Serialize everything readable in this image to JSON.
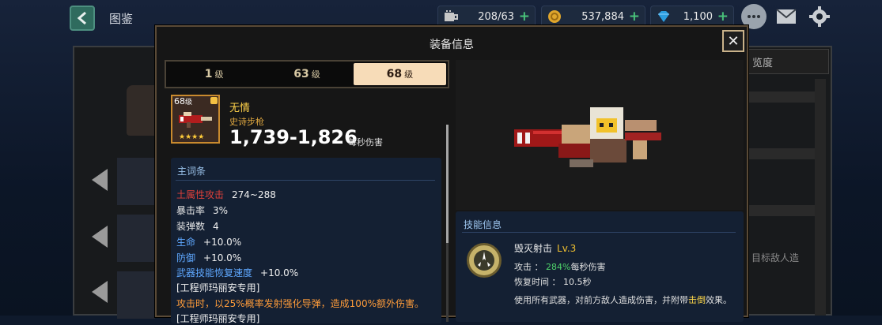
{
  "topbar": {
    "title": "图鉴",
    "resources": [
      {
        "icon": "coffee-cup-icon",
        "value": "208/63"
      },
      {
        "icon": "gold-coin-icon",
        "value": "537,884"
      },
      {
        "icon": "gem-icon",
        "value": "1,100"
      }
    ],
    "plus_label": "+"
  },
  "background": {
    "right_tab_label": "览度",
    "right_snippet": "目标敌人造"
  },
  "modal": {
    "title": "装备信息",
    "close_label": "✕",
    "tabs": [
      {
        "num": "1",
        "unit": "级",
        "active": false
      },
      {
        "num": "63",
        "unit": "级",
        "active": false
      },
      {
        "num": "68",
        "unit": "级",
        "active": true
      }
    ],
    "item": {
      "level": "68",
      "level_unit": "级",
      "stars": "★★★★",
      "name": "无情",
      "type": "史诗步枪",
      "damage": "1,739-1,826",
      "damage_label": "每秒伤害"
    },
    "stats": {
      "header": "主词条",
      "rows": [
        {
          "key": "土属性攻击",
          "value": "274~288",
          "color": "#e0403a"
        },
        {
          "key": "暴击率",
          "value": "3%",
          "color": "#f0f0f0"
        },
        {
          "key": "装弹数",
          "value": "4",
          "color": "#f0f0f0"
        },
        {
          "key": "生命",
          "value": "+10.0%",
          "color": "#5fa8ff"
        },
        {
          "key": "防御",
          "value": "+10.0%",
          "color": "#5fa8ff"
        },
        {
          "key": "武器技能恢复速度",
          "value": "+10.0%",
          "color": "#5fa8ff"
        }
      ],
      "bracket1": "[工程师玛丽安专用]",
      "bonus1": "攻击时，以25%概率发射强化导弹，造成100%额外伤害。",
      "bracket2": "[工程师玛丽安专用]"
    },
    "skill": {
      "header": "技能信息",
      "name": "毁灭射击",
      "level": "Lv.3",
      "attack_label": "攻击 ：",
      "attack_pct": "284%",
      "attack_suffix": "每秒伤害",
      "cooldown": "恢复时间 ： 10.5秒",
      "desc_pre": "使用所有武器，对前方敌人造成伤害，并附带",
      "desc_hl": "击倒",
      "desc_post": "效果。"
    }
  }
}
